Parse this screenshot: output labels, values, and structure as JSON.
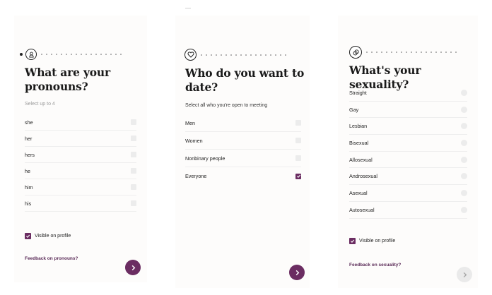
{
  "screens": [
    {
      "title": "What are your pronouns?",
      "subtitle": "Select up to 4",
      "options": [
        "she",
        "her",
        "hers",
        "he",
        "him",
        "his"
      ],
      "visible_on_profile": "Visible on profile",
      "feedback": "Feedback on pronouns?",
      "step_icon": "person-icon",
      "next_enabled": true
    },
    {
      "title": "Who do you want to date?",
      "subtitle": "Select all who you're open to meeting",
      "options": [
        "Men",
        "Women",
        "Nonbinary people",
        "Everyone"
      ],
      "selected": [
        "Everyone"
      ],
      "step_icon": "heart-icon",
      "next_enabled": true
    },
    {
      "title": "What's your sexuality?",
      "options": [
        "Straight",
        "Gay",
        "Lesbian",
        "Bisexual",
        "Allosexual",
        "Androsexual",
        "Asexual",
        "Autosexual"
      ],
      "visible_on_profile": "Visible on profile",
      "feedback": "Feedback on sexuality?",
      "step_icon": "rings-icon",
      "next_enabled": false
    }
  ],
  "colors": {
    "accent": "#6b2d62",
    "checkbox_empty": "#ececec",
    "panel_bg": "#fdfcfb"
  }
}
